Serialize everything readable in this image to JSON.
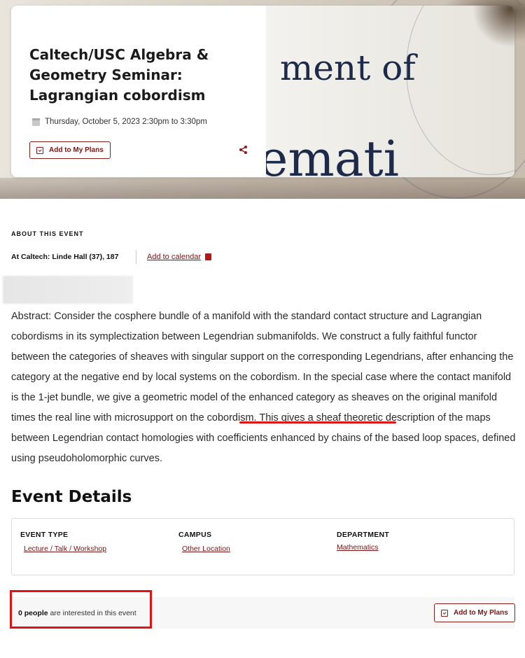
{
  "hero": {
    "title": "Caltech/USC Algebra & Geometry Seminar: Lagrangian cobordism",
    "date": "Thursday, October 5, 2023 2:30pm to 3:30pm",
    "add_plans_label": "Add to My Plans",
    "bg_text_1": "ment of",
    "bg_text_2": "emati",
    "share_icon": "share-icon"
  },
  "about": {
    "heading": "ABOUT THIS EVENT",
    "location": "At Caltech: Linde Hall (37), 187",
    "add_calendar_label": "Add to calendar",
    "abstract_before": "Abstract: Consider the cosphere bundle of a manifold with the standard contact structure and Lagrangian cobordisms in its symplectization between Legendrian submanifolds. We construct a fully faithful functor between the categories of sheaves with singular support on the corresponding Legendrians, after enhancing the category at the negative end by local systems on the cobordism. In the special case where the contact manifold is the 1-jet bundle, we give a geometric model of the enhanced category as sheaves on the original manifold times the real line with ",
    "abstract_highlight": "microsupport on the cobordism.",
    "abstract_after": " This gives a sheaf theoretic description of the maps between Legendrian contact homologies with coefficients enhanced by chains of the based loop spaces, defined using pseudoholomorphic curves."
  },
  "details": {
    "heading": "Event Details",
    "event_type_label": "EVENT TYPE",
    "event_type_value": "Lecture / Talk / Workshop",
    "campus_label": "CAMPUS",
    "campus_value": "Other Location",
    "department_label": "DEPARTMENT",
    "department_value": "Mathematics"
  },
  "interest": {
    "count": "0 people",
    "suffix": " are interested in this event",
    "add_plans_label": "Add to My Plans"
  },
  "colors": {
    "accent": "#7a1414",
    "annotation": "#e01414"
  }
}
